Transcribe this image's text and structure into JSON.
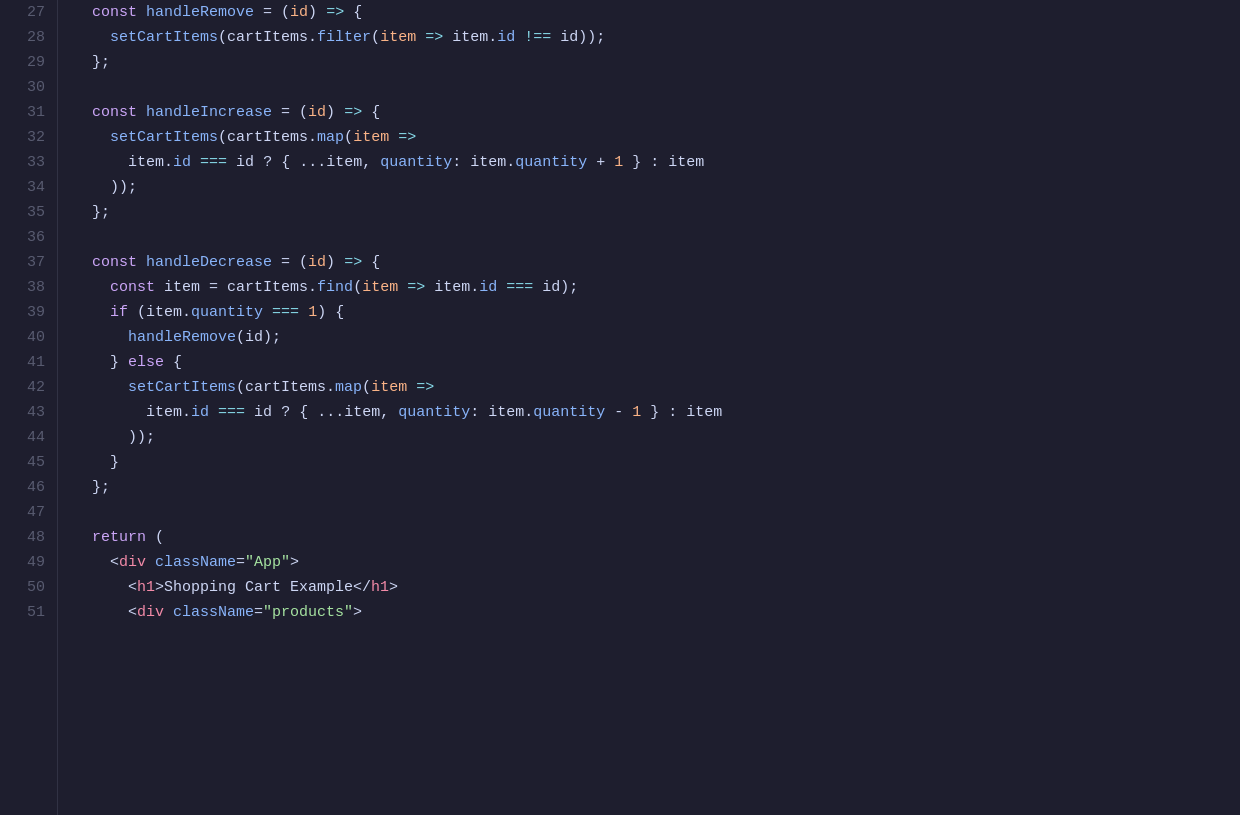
{
  "editor": {
    "background": "#1e1e2e",
    "lines": [
      {
        "number": 27,
        "tokens": [
          {
            "t": "plain",
            "v": "  "
          },
          {
            "t": "kw",
            "v": "const"
          },
          {
            "t": "plain",
            "v": " "
          },
          {
            "t": "fn",
            "v": "handleRemove"
          },
          {
            "t": "plain",
            "v": " = ("
          },
          {
            "t": "param",
            "v": "id"
          },
          {
            "t": "plain",
            "v": ") "
          },
          {
            "t": "arrow",
            "v": "=>"
          },
          {
            "t": "plain",
            "v": " {"
          }
        ]
      },
      {
        "number": 28,
        "tokens": [
          {
            "t": "plain",
            "v": "    "
          },
          {
            "t": "fn",
            "v": "setCartItems"
          },
          {
            "t": "plain",
            "v": "("
          },
          {
            "t": "var",
            "v": "cartItems"
          },
          {
            "t": "plain",
            "v": "."
          },
          {
            "t": "method",
            "v": "filter"
          },
          {
            "t": "plain",
            "v": "("
          },
          {
            "t": "param",
            "v": "item"
          },
          {
            "t": "plain",
            "v": " "
          },
          {
            "t": "arrow",
            "v": "=>"
          },
          {
            "t": "plain",
            "v": " "
          },
          {
            "t": "var",
            "v": "item"
          },
          {
            "t": "plain",
            "v": "."
          },
          {
            "t": "prop",
            "v": "id"
          },
          {
            "t": "plain",
            "v": " "
          },
          {
            "t": "op",
            "v": "!=="
          },
          {
            "t": "plain",
            "v": " "
          },
          {
            "t": "var",
            "v": "id"
          },
          {
            "t": "plain",
            "v": "));"
          }
        ]
      },
      {
        "number": 29,
        "tokens": [
          {
            "t": "plain",
            "v": "  };"
          }
        ]
      },
      {
        "number": 30,
        "tokens": []
      },
      {
        "number": 31,
        "tokens": [
          {
            "t": "plain",
            "v": "  "
          },
          {
            "t": "kw",
            "v": "const"
          },
          {
            "t": "plain",
            "v": " "
          },
          {
            "t": "fn",
            "v": "handleIncrease"
          },
          {
            "t": "plain",
            "v": " = ("
          },
          {
            "t": "param",
            "v": "id"
          },
          {
            "t": "plain",
            "v": ") "
          },
          {
            "t": "arrow",
            "v": "=>"
          },
          {
            "t": "plain",
            "v": " {"
          }
        ]
      },
      {
        "number": 32,
        "tokens": [
          {
            "t": "plain",
            "v": "    "
          },
          {
            "t": "fn",
            "v": "setCartItems"
          },
          {
            "t": "plain",
            "v": "("
          },
          {
            "t": "var",
            "v": "cartItems"
          },
          {
            "t": "plain",
            "v": "."
          },
          {
            "t": "method",
            "v": "map"
          },
          {
            "t": "plain",
            "v": "("
          },
          {
            "t": "param",
            "v": "item"
          },
          {
            "t": "plain",
            "v": " "
          },
          {
            "t": "arrow",
            "v": "=>"
          }
        ]
      },
      {
        "number": 33,
        "tokens": [
          {
            "t": "plain",
            "v": "      "
          },
          {
            "t": "var",
            "v": "item"
          },
          {
            "t": "plain",
            "v": "."
          },
          {
            "t": "prop",
            "v": "id"
          },
          {
            "t": "plain",
            "v": " "
          },
          {
            "t": "op",
            "v": "==="
          },
          {
            "t": "plain",
            "v": " "
          },
          {
            "t": "var",
            "v": "id"
          },
          {
            "t": "plain",
            "v": " ? { "
          },
          {
            "t": "spread",
            "v": "..."
          },
          {
            "t": "var",
            "v": "item"
          },
          {
            "t": "plain",
            "v": ", "
          },
          {
            "t": "prop",
            "v": "quantity"
          },
          {
            "t": "plain",
            "v": ": "
          },
          {
            "t": "var",
            "v": "item"
          },
          {
            "t": "plain",
            "v": "."
          },
          {
            "t": "prop",
            "v": "quantity"
          },
          {
            "t": "plain",
            "v": " + "
          },
          {
            "t": "num",
            "v": "1"
          },
          {
            "t": "plain",
            "v": " } : "
          },
          {
            "t": "var",
            "v": "item"
          }
        ]
      },
      {
        "number": 34,
        "tokens": [
          {
            "t": "plain",
            "v": "    ));"
          }
        ]
      },
      {
        "number": 35,
        "tokens": [
          {
            "t": "plain",
            "v": "  };"
          }
        ]
      },
      {
        "number": 36,
        "tokens": []
      },
      {
        "number": 37,
        "tokens": [
          {
            "t": "plain",
            "v": "  "
          },
          {
            "t": "kw",
            "v": "const"
          },
          {
            "t": "plain",
            "v": " "
          },
          {
            "t": "fn",
            "v": "handleDecrease"
          },
          {
            "t": "plain",
            "v": " = ("
          },
          {
            "t": "param",
            "v": "id"
          },
          {
            "t": "plain",
            "v": ") "
          },
          {
            "t": "arrow",
            "v": "=>"
          },
          {
            "t": "plain",
            "v": " {"
          }
        ]
      },
      {
        "number": 38,
        "tokens": [
          {
            "t": "plain",
            "v": "    "
          },
          {
            "t": "kw",
            "v": "const"
          },
          {
            "t": "plain",
            "v": " "
          },
          {
            "t": "var",
            "v": "item"
          },
          {
            "t": "plain",
            "v": " = "
          },
          {
            "t": "var",
            "v": "cartItems"
          },
          {
            "t": "plain",
            "v": "."
          },
          {
            "t": "method",
            "v": "find"
          },
          {
            "t": "plain",
            "v": "("
          },
          {
            "t": "param",
            "v": "item"
          },
          {
            "t": "plain",
            "v": " "
          },
          {
            "t": "arrow",
            "v": "=>"
          },
          {
            "t": "plain",
            "v": " "
          },
          {
            "t": "var",
            "v": "item"
          },
          {
            "t": "plain",
            "v": "."
          },
          {
            "t": "prop",
            "v": "id"
          },
          {
            "t": "plain",
            "v": " "
          },
          {
            "t": "op",
            "v": "==="
          },
          {
            "t": "plain",
            "v": " "
          },
          {
            "t": "var",
            "v": "id"
          },
          {
            "t": "plain",
            "v": ");"
          }
        ]
      },
      {
        "number": 39,
        "tokens": [
          {
            "t": "plain",
            "v": "    "
          },
          {
            "t": "kw",
            "v": "if"
          },
          {
            "t": "plain",
            "v": " ("
          },
          {
            "t": "var",
            "v": "item"
          },
          {
            "t": "plain",
            "v": "."
          },
          {
            "t": "prop",
            "v": "quantity"
          },
          {
            "t": "plain",
            "v": " "
          },
          {
            "t": "op",
            "v": "==="
          },
          {
            "t": "plain",
            "v": " "
          },
          {
            "t": "num",
            "v": "1"
          },
          {
            "t": "plain",
            "v": ") {"
          }
        ]
      },
      {
        "number": 40,
        "tokens": [
          {
            "t": "plain",
            "v": "      "
          },
          {
            "t": "fn",
            "v": "handleRemove"
          },
          {
            "t": "plain",
            "v": "("
          },
          {
            "t": "var",
            "v": "id"
          },
          {
            "t": "plain",
            "v": ");"
          }
        ]
      },
      {
        "number": 41,
        "tokens": [
          {
            "t": "plain",
            "v": "    } "
          },
          {
            "t": "kw",
            "v": "else"
          },
          {
            "t": "plain",
            "v": " {"
          }
        ]
      },
      {
        "number": 42,
        "tokens": [
          {
            "t": "plain",
            "v": "      "
          },
          {
            "t": "fn",
            "v": "setCartItems"
          },
          {
            "t": "plain",
            "v": "("
          },
          {
            "t": "var",
            "v": "cartItems"
          },
          {
            "t": "plain",
            "v": "."
          },
          {
            "t": "method",
            "v": "map"
          },
          {
            "t": "plain",
            "v": "("
          },
          {
            "t": "param",
            "v": "item"
          },
          {
            "t": "plain",
            "v": " "
          },
          {
            "t": "arrow",
            "v": "=>"
          }
        ]
      },
      {
        "number": 43,
        "tokens": [
          {
            "t": "plain",
            "v": "        "
          },
          {
            "t": "var",
            "v": "item"
          },
          {
            "t": "plain",
            "v": "."
          },
          {
            "t": "prop",
            "v": "id"
          },
          {
            "t": "plain",
            "v": " "
          },
          {
            "t": "op",
            "v": "==="
          },
          {
            "t": "plain",
            "v": " "
          },
          {
            "t": "var",
            "v": "id"
          },
          {
            "t": "plain",
            "v": " ? { "
          },
          {
            "t": "spread",
            "v": "..."
          },
          {
            "t": "var",
            "v": "item"
          },
          {
            "t": "plain",
            "v": ", "
          },
          {
            "t": "prop",
            "v": "quantity"
          },
          {
            "t": "plain",
            "v": ": "
          },
          {
            "t": "var",
            "v": "item"
          },
          {
            "t": "plain",
            "v": "."
          },
          {
            "t": "prop",
            "v": "quantity"
          },
          {
            "t": "plain",
            "v": " - "
          },
          {
            "t": "num",
            "v": "1"
          },
          {
            "t": "plain",
            "v": " } : "
          },
          {
            "t": "var",
            "v": "item"
          }
        ]
      },
      {
        "number": 44,
        "tokens": [
          {
            "t": "plain",
            "v": "      ));"
          }
        ]
      },
      {
        "number": 45,
        "tokens": [
          {
            "t": "plain",
            "v": "    }"
          }
        ]
      },
      {
        "number": 46,
        "tokens": [
          {
            "t": "plain",
            "v": "  };"
          }
        ]
      },
      {
        "number": 47,
        "tokens": []
      },
      {
        "number": 48,
        "tokens": [
          {
            "t": "plain",
            "v": "  "
          },
          {
            "t": "kw",
            "v": "return"
          },
          {
            "t": "plain",
            "v": " ("
          }
        ]
      },
      {
        "number": 49,
        "tokens": [
          {
            "t": "plain",
            "v": "    <"
          },
          {
            "t": "tag",
            "v": "div"
          },
          {
            "t": "plain",
            "v": " "
          },
          {
            "t": "attr",
            "v": "className"
          },
          {
            "t": "plain",
            "v": "="
          },
          {
            "t": "attr-val",
            "v": "\"App\""
          },
          {
            "t": "plain",
            "v": ">"
          }
        ]
      },
      {
        "number": 50,
        "tokens": [
          {
            "t": "plain",
            "v": "      <"
          },
          {
            "t": "tag",
            "v": "h1"
          },
          {
            "t": "plain",
            "v": ">Shopping Cart Example</"
          },
          {
            "t": "tag",
            "v": "h1"
          },
          {
            "t": "plain",
            "v": ">"
          }
        ]
      },
      {
        "number": 51,
        "tokens": [
          {
            "t": "plain",
            "v": "      <"
          },
          {
            "t": "tag",
            "v": "div"
          },
          {
            "t": "plain",
            "v": " "
          },
          {
            "t": "attr",
            "v": "className"
          },
          {
            "t": "plain",
            "v": "="
          },
          {
            "t": "attr-val",
            "v": "\"products\""
          },
          {
            "t": "plain",
            "v": ">"
          }
        ]
      }
    ]
  }
}
